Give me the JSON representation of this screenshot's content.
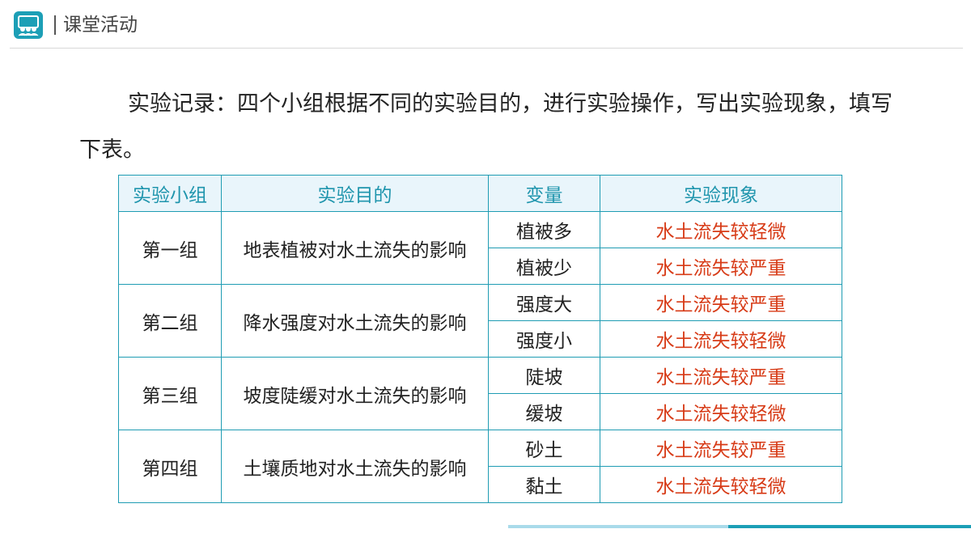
{
  "header": {
    "title": "课堂活动",
    "icon": "classroom-people-icon",
    "accent": "#1c9fb6"
  },
  "intro": {
    "text": "实验记录：四个小组根据不同的实验目的，进行实验操作，写出实验现象，填写下表。"
  },
  "table": {
    "headers": [
      "实验小组",
      "实验目的",
      "变量",
      "实验现象"
    ],
    "groups": [
      {
        "name": "第一组",
        "purpose": "地表植被对水土流失的影响",
        "rows": [
          {
            "variable": "植被多",
            "result": "水土流失较轻微"
          },
          {
            "variable": "植被少",
            "result": "水土流失较严重"
          }
        ]
      },
      {
        "name": "第二组",
        "purpose": "降水强度对水土流失的影响",
        "rows": [
          {
            "variable": "强度大",
            "result": "水土流失较严重"
          },
          {
            "variable": "强度小",
            "result": "水土流失较轻微"
          }
        ]
      },
      {
        "name": "第三组",
        "purpose": "坡度陡缓对水土流失的影响",
        "rows": [
          {
            "variable": "陡坡",
            "result": "水土流失较严重"
          },
          {
            "variable": "缓坡",
            "result": "水土流失较轻微"
          }
        ]
      },
      {
        "name": "第四组",
        "purpose": "土壤质地对水土流失的影响",
        "rows": [
          {
            "variable": "砂土",
            "result": "水土流失较严重"
          },
          {
            "variable": "黏土",
            "result": "水土流失较轻微"
          }
        ]
      }
    ]
  },
  "colors": {
    "border": "#1f9cb3",
    "header_text": "#1f95ad",
    "header_bg": "#e9f5fb",
    "result_text": "#d73b17"
  }
}
